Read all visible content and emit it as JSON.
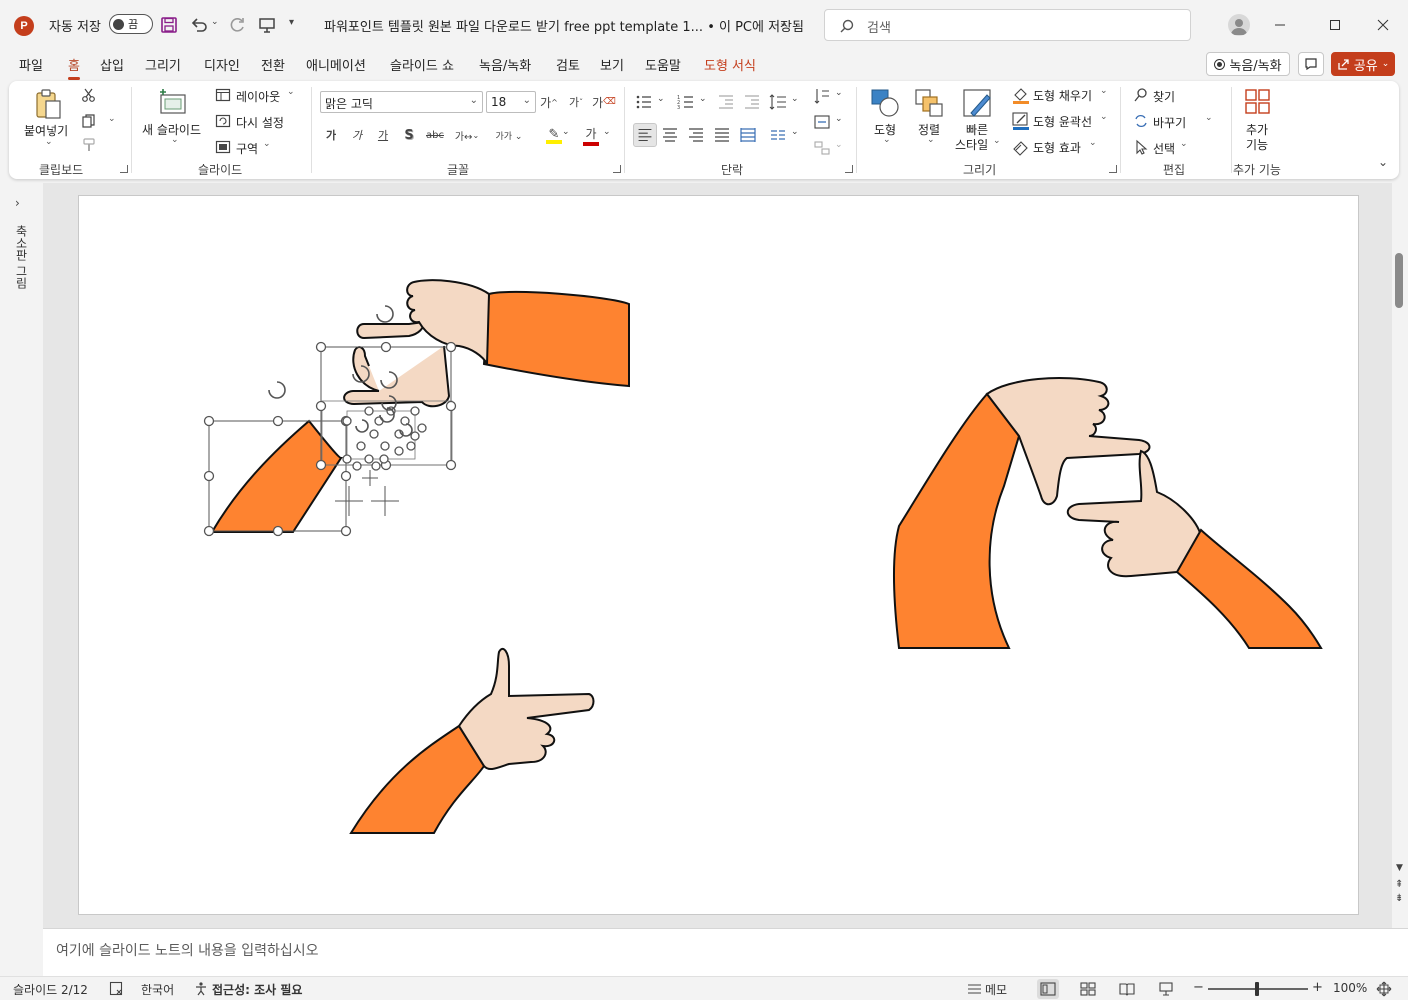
{
  "titlebar": {
    "autosave_label": "자동 저장",
    "autosave_state": "끔",
    "title": "파워포인트 템플릿 원본 파일 다운로드 받기 free ppt template 1... • 이 PC에 저장됨",
    "search_placeholder": "검색"
  },
  "tabs": [
    "파일",
    "홈",
    "삽입",
    "그리기",
    "디자인",
    "전환",
    "애니메이션",
    "슬라이드 쇼",
    "녹음/녹화",
    "검토",
    "보기",
    "도움말",
    "도형 서식"
  ],
  "header_buttons": {
    "record": "녹음/녹화",
    "share": "공유"
  },
  "ribbon": {
    "clipboard": {
      "paste": "붙여넣기",
      "label": "클립보드"
    },
    "slides": {
      "new_slide_1": "새 슬라이드",
      "layout": "레이아웃",
      "reset": "다시 설정",
      "section": "구역",
      "label": "슬라이드"
    },
    "font": {
      "font_name": "맑은 고딕",
      "font_size": "18",
      "label": "글꼴"
    },
    "paragraph": {
      "label": "단락"
    },
    "drawing": {
      "shapes": "도형",
      "arrange": "정렬",
      "quick_styles_1": "빠른",
      "quick_styles_2": "스타일",
      "fill": "도형 채우기",
      "outline": "도형 윤곽선",
      "effects": "도형 효과",
      "label": "그리기"
    },
    "editing": {
      "find": "찾기",
      "replace": "바꾸기",
      "select": "선택",
      "label": "편집"
    },
    "addins": {
      "addins_1": "추가",
      "addins_2": "기능",
      "label": "추가 기능"
    }
  },
  "leftpane": {
    "thumbnails_label": "축소판 그림"
  },
  "notes": {
    "placeholder": "여기에 슬라이드 노트의 내용을 입력하십시오"
  },
  "statusbar": {
    "slide_info": "슬라이드 2/12",
    "language": "한국어",
    "accessibility": "접근성: 조사 필요",
    "notes_btn": "메모",
    "zoom": "100%"
  },
  "colors": {
    "accent": "#c43e1c",
    "sleeve": "#fe8330",
    "skin": "#f4d9c4"
  }
}
